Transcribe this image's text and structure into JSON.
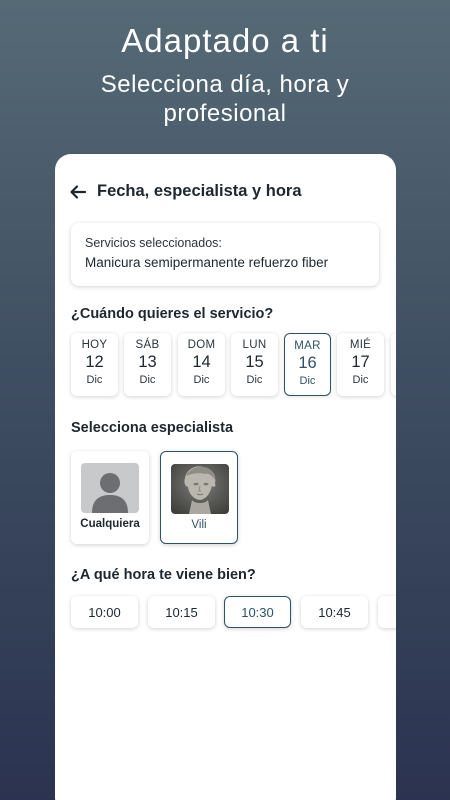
{
  "hero": {
    "title": "Adaptado a ti",
    "subtitle": "Selecciona día, hora y profesional"
  },
  "header": {
    "back_icon": "arrow-left-icon",
    "title": "Fecha, especialista y hora"
  },
  "services": {
    "label": "Servicios seleccionados:",
    "value": "Manicura semipermanente refuerzo fiber"
  },
  "dates": {
    "title": "¿Cuándo quieres el servicio?",
    "selected_index": 4,
    "items": [
      {
        "day": "HOY",
        "date": "12",
        "month": "Dic"
      },
      {
        "day": "SÁB",
        "date": "13",
        "month": "Dic"
      },
      {
        "day": "DOM",
        "date": "14",
        "month": "Dic"
      },
      {
        "day": "LUN",
        "date": "15",
        "month": "Dic"
      },
      {
        "day": "MAR",
        "date": "16",
        "month": "Dic"
      },
      {
        "day": "MIÉ",
        "date": "17",
        "month": "Dic"
      }
    ]
  },
  "specialists": {
    "title": "Selecciona especialista",
    "selected_index": 1,
    "items": [
      {
        "name": "Cualquiera",
        "icon": "person-placeholder-icon"
      },
      {
        "name": "Vili",
        "icon": "statue-photo"
      }
    ]
  },
  "times": {
    "title": "¿A qué hora te viene bien?",
    "selected_index": 2,
    "items": [
      "10:00",
      "10:15",
      "10:30",
      "10:45"
    ]
  },
  "colors": {
    "accent": "#2f5266",
    "background_top": "#566a76",
    "background_bottom": "#2b3350"
  }
}
